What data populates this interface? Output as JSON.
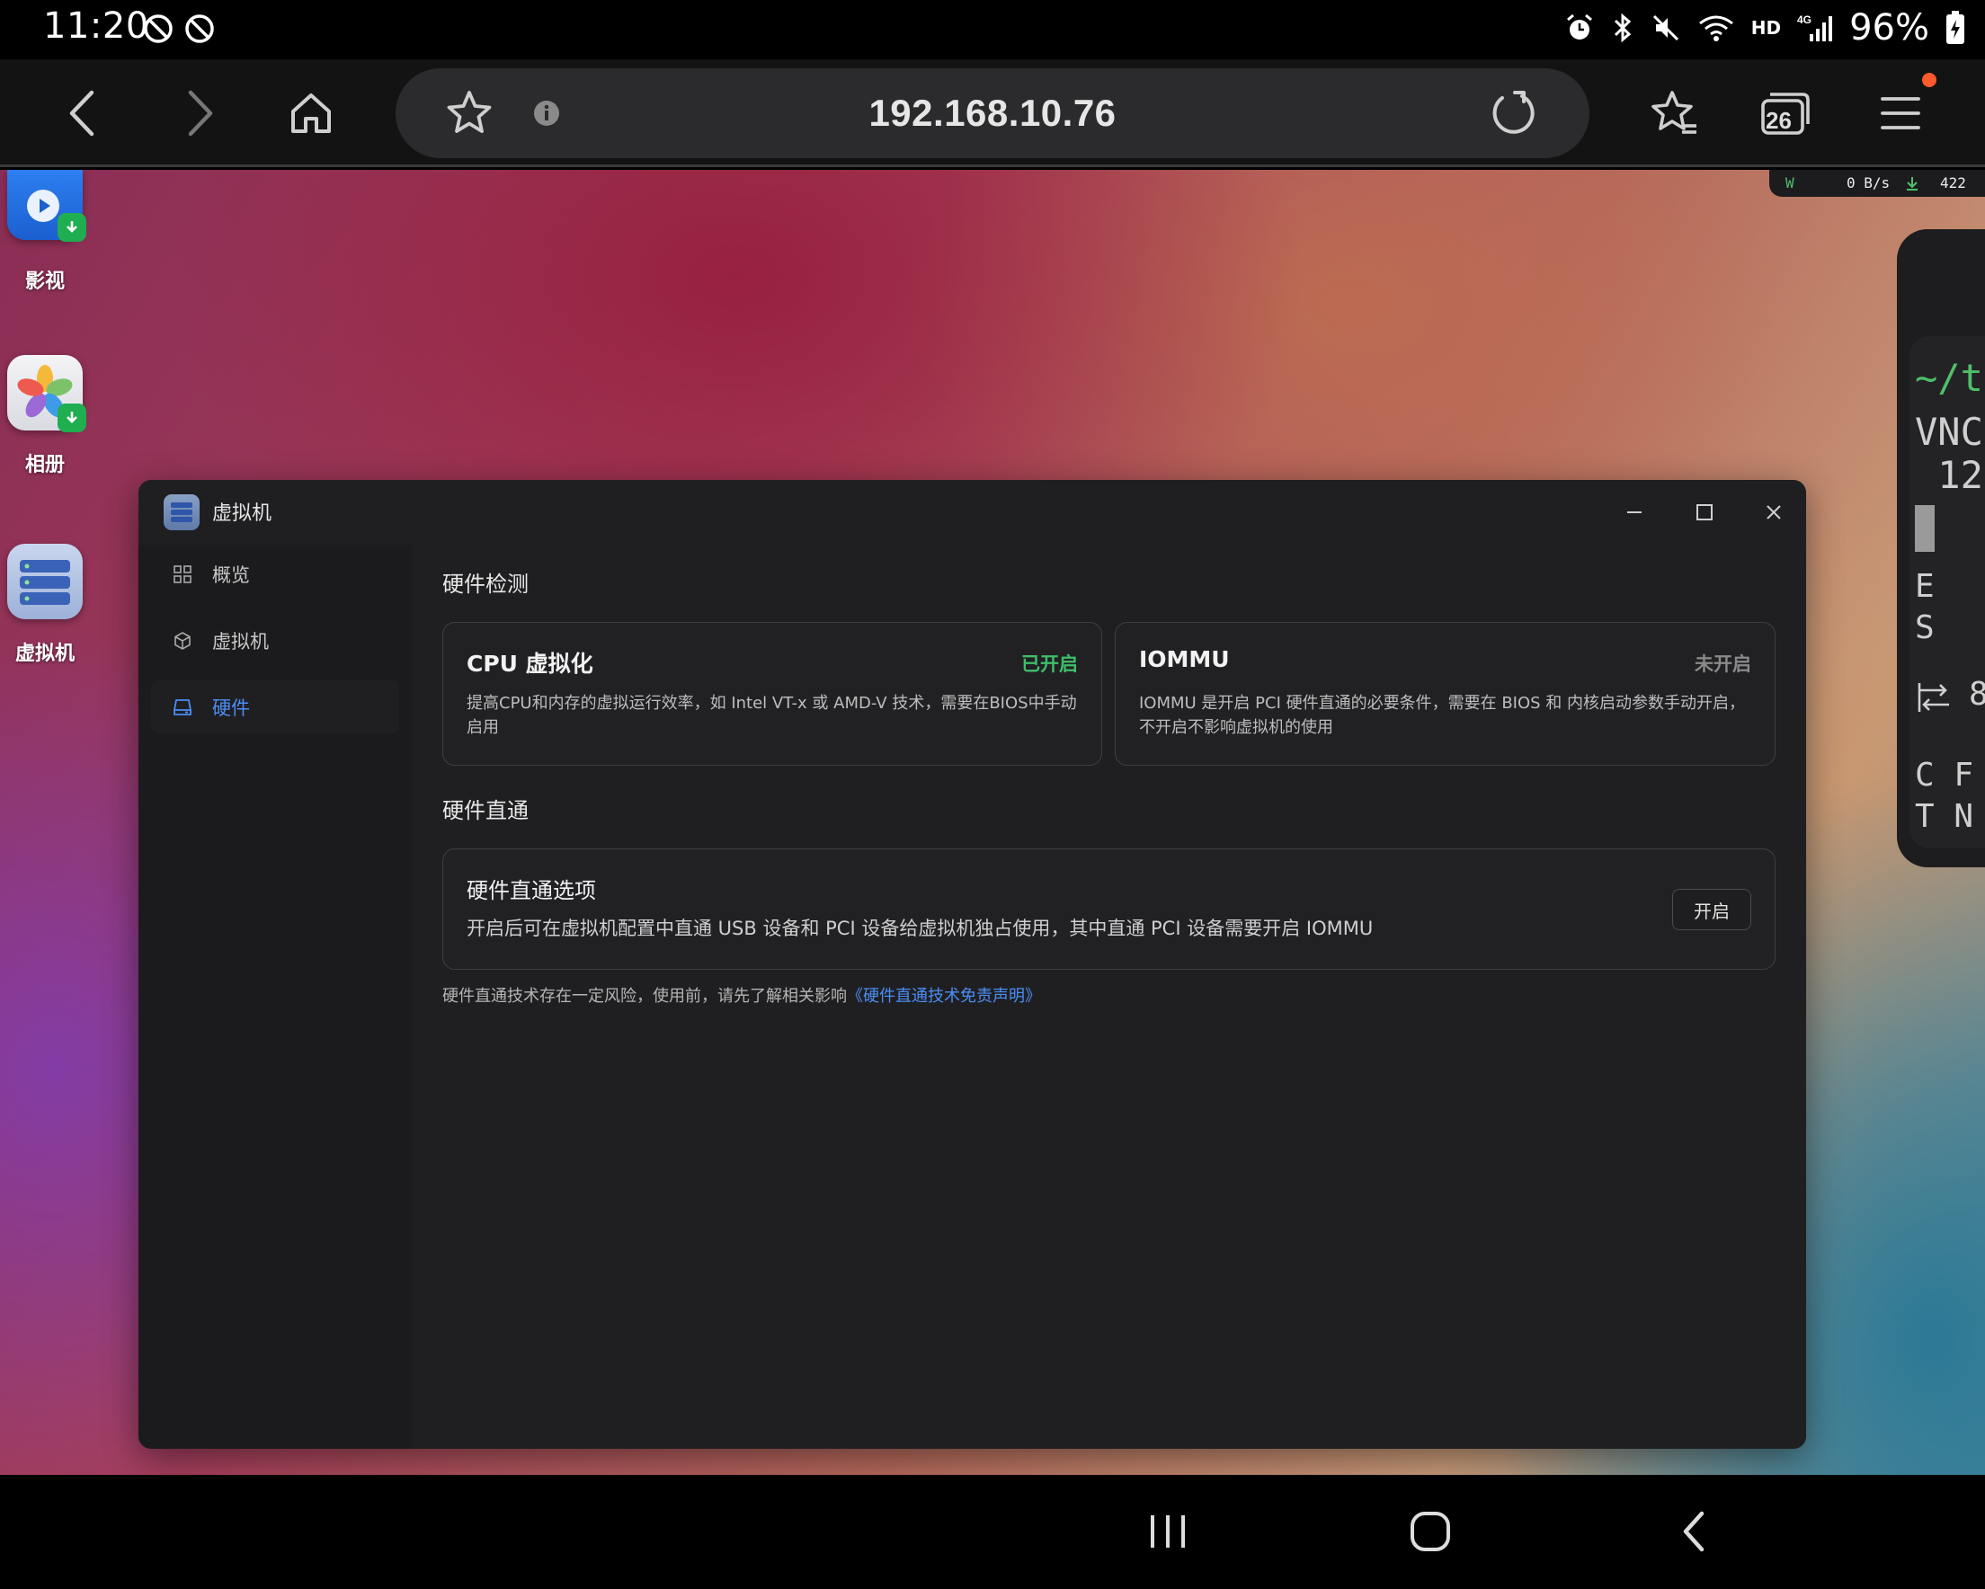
{
  "status_bar": {
    "time": "11:20",
    "network": "HD",
    "battery_percent": "96%",
    "icons": [
      "prohibited-icon",
      "prohibited-icon",
      "alarm-icon",
      "bluetooth-icon",
      "mute-icon",
      "wifi-icon",
      "signal-4g-icon",
      "battery-charging-icon"
    ]
  },
  "browser": {
    "url": "192.168.10.76",
    "tab_count": "26",
    "buttons": [
      "back-icon",
      "forward-icon",
      "home-icon",
      "bookmark-star-icon",
      "info-icon",
      "reload-icon",
      "bookmarks-icon",
      "tabs-icon",
      "menu-icon"
    ]
  },
  "desktop": {
    "speed_indicator": {
      "prefix": "W",
      "speed": "0 B/s",
      "count": "422"
    },
    "apps": [
      {
        "label": "影视",
        "icon": "video-app-icon"
      },
      {
        "label": "相册",
        "icon": "photos-app-icon"
      },
      {
        "label": "虚拟机",
        "icon": "vm-app-icon"
      }
    ],
    "terminal_peek": {
      "lines": [
        "~/t",
        "VNC",
        " 12",
        "E",
        "S",
        "8",
        "C F",
        "T N"
      ]
    }
  },
  "vm_window": {
    "title": "虚拟机",
    "sidebar": [
      {
        "label": "概览",
        "icon": "grid-icon",
        "active": false
      },
      {
        "label": "虚拟机",
        "icon": "cube-icon",
        "active": false
      },
      {
        "label": "硬件",
        "icon": "drive-icon",
        "active": true
      }
    ],
    "hardware_detection": {
      "title": "硬件检测",
      "cards": [
        {
          "title": "CPU 虚拟化",
          "status": "已开启",
          "status_color": "#3fbf6a",
          "description": "提高CPU和内存的虚拟运行效率，如 Intel VT-x 或 AMD-V 技术，需要在BIOS中手动启用"
        },
        {
          "title": "IOMMU",
          "status": "未开启",
          "status_color": "#8a8a8a",
          "description": "IOMMU 是开启 PCI 硬件直通的必要条件，需要在 BIOS 和 内核启动参数手动开启，不开启不影响虚拟机的使用"
        }
      ]
    },
    "passthrough": {
      "title": "硬件直通",
      "option_title": "硬件直通选项",
      "option_desc": "开启后可在虚拟机配置中直通 USB 设备和 PCI 设备给虚拟机独占使用，其中直通 PCI 设备需要开启 IOMMU",
      "button_label": "开启"
    },
    "footnote": {
      "text": "硬件直通技术存在一定风险，使用前，请先了解相关影响",
      "link": "《硬件直通技术免责声明》"
    },
    "accent_color": "#4b8ef5"
  }
}
